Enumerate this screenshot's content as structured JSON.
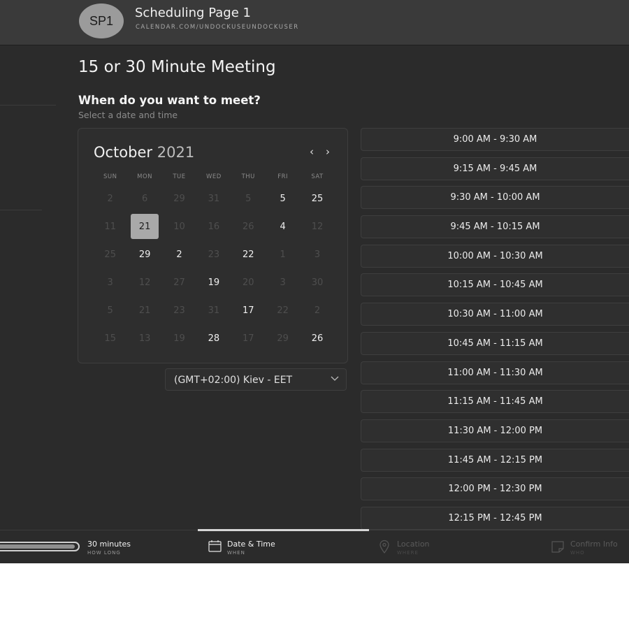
{
  "header": {
    "avatar_initials": "SP1",
    "page_name": "Scheduling Page 1",
    "page_url": "CALENDAR.COM/UNDOCKUSEUNDOCKUSER"
  },
  "meeting_title": "15 or 30 Minute Meeting",
  "question": "When do you want to meet?",
  "subquestion": "Select a date and time",
  "calendar": {
    "month": "October",
    "year": "2021",
    "prev_label": "‹",
    "next_label": "›",
    "weekdays": [
      "SUN",
      "MON",
      "TUE",
      "WED",
      "THU",
      "FRI",
      "SAT"
    ],
    "days": [
      {
        "label": "2",
        "state": "muted"
      },
      {
        "label": "6",
        "state": "muted"
      },
      {
        "label": "29",
        "state": "muted"
      },
      {
        "label": "31",
        "state": "muted"
      },
      {
        "label": "5",
        "state": "muted"
      },
      {
        "label": "5",
        "state": "avail"
      },
      {
        "label": "25",
        "state": "avail"
      },
      {
        "label": "11",
        "state": "muted"
      },
      {
        "label": "21",
        "state": "selected"
      },
      {
        "label": "10",
        "state": "muted"
      },
      {
        "label": "16",
        "state": "muted"
      },
      {
        "label": "26",
        "state": "muted"
      },
      {
        "label": "4",
        "state": "avail"
      },
      {
        "label": "12",
        "state": "muted"
      },
      {
        "label": "25",
        "state": "muted"
      },
      {
        "label": "29",
        "state": "avail"
      },
      {
        "label": "2",
        "state": "avail"
      },
      {
        "label": "23",
        "state": "muted"
      },
      {
        "label": "22",
        "state": "avail"
      },
      {
        "label": "1",
        "state": "muted"
      },
      {
        "label": "3",
        "state": "muted"
      },
      {
        "label": "3",
        "state": "muted"
      },
      {
        "label": "12",
        "state": "muted"
      },
      {
        "label": "27",
        "state": "muted"
      },
      {
        "label": "19",
        "state": "avail"
      },
      {
        "label": "20",
        "state": "muted"
      },
      {
        "label": "3",
        "state": "muted"
      },
      {
        "label": "30",
        "state": "muted"
      },
      {
        "label": "5",
        "state": "muted"
      },
      {
        "label": "21",
        "state": "muted"
      },
      {
        "label": "23",
        "state": "muted"
      },
      {
        "label": "31",
        "state": "muted"
      },
      {
        "label": "17",
        "state": "avail"
      },
      {
        "label": "22",
        "state": "muted"
      },
      {
        "label": "2",
        "state": "muted"
      },
      {
        "label": "15",
        "state": "muted"
      },
      {
        "label": "13",
        "state": "muted"
      },
      {
        "label": "19",
        "state": "muted"
      },
      {
        "label": "28",
        "state": "avail"
      },
      {
        "label": "17",
        "state": "muted"
      },
      {
        "label": "29",
        "state": "muted"
      },
      {
        "label": "26",
        "state": "avail"
      }
    ]
  },
  "timezone": {
    "label": "(GMT+02:00) Kiev - EET",
    "chevron_icon": "chevron-down-icon"
  },
  "time_slots": [
    "9:00 AM - 9:30 AM",
    "9:15 AM - 9:45 AM",
    "9:30 AM - 10:00 AM",
    "9:45 AM - 10:15 AM",
    "10:00 AM - 10:30 AM",
    "10:15 AM - 10:45 AM",
    "10:30 AM - 11:00 AM",
    "10:45 AM - 11:15 AM",
    "11:00 AM - 11:30 AM",
    "11:15 AM - 11:45 AM",
    "11:30 AM - 12:00 PM",
    "11:45 AM - 12:15 PM",
    "12:00 PM - 12:30 PM",
    "12:15 PM - 12:45 PM"
  ],
  "steps": {
    "duration": {
      "label": "30 minutes",
      "sub": "HOW LONG",
      "progress": 0.97
    },
    "datetime": {
      "label": "Date & Time",
      "sub": "WHEN",
      "icon": "calendar-icon"
    },
    "location": {
      "label": "Location",
      "sub": "WHERE",
      "icon": "location-pin-icon"
    },
    "confirm": {
      "label": "Confirm Info",
      "sub": "WHO",
      "icon": "note-icon"
    }
  },
  "colors": {
    "background": "#2b2b2b",
    "header": "#3a3a3a",
    "selected_day": "#a9a9a9",
    "text": "#e8e8e8"
  }
}
